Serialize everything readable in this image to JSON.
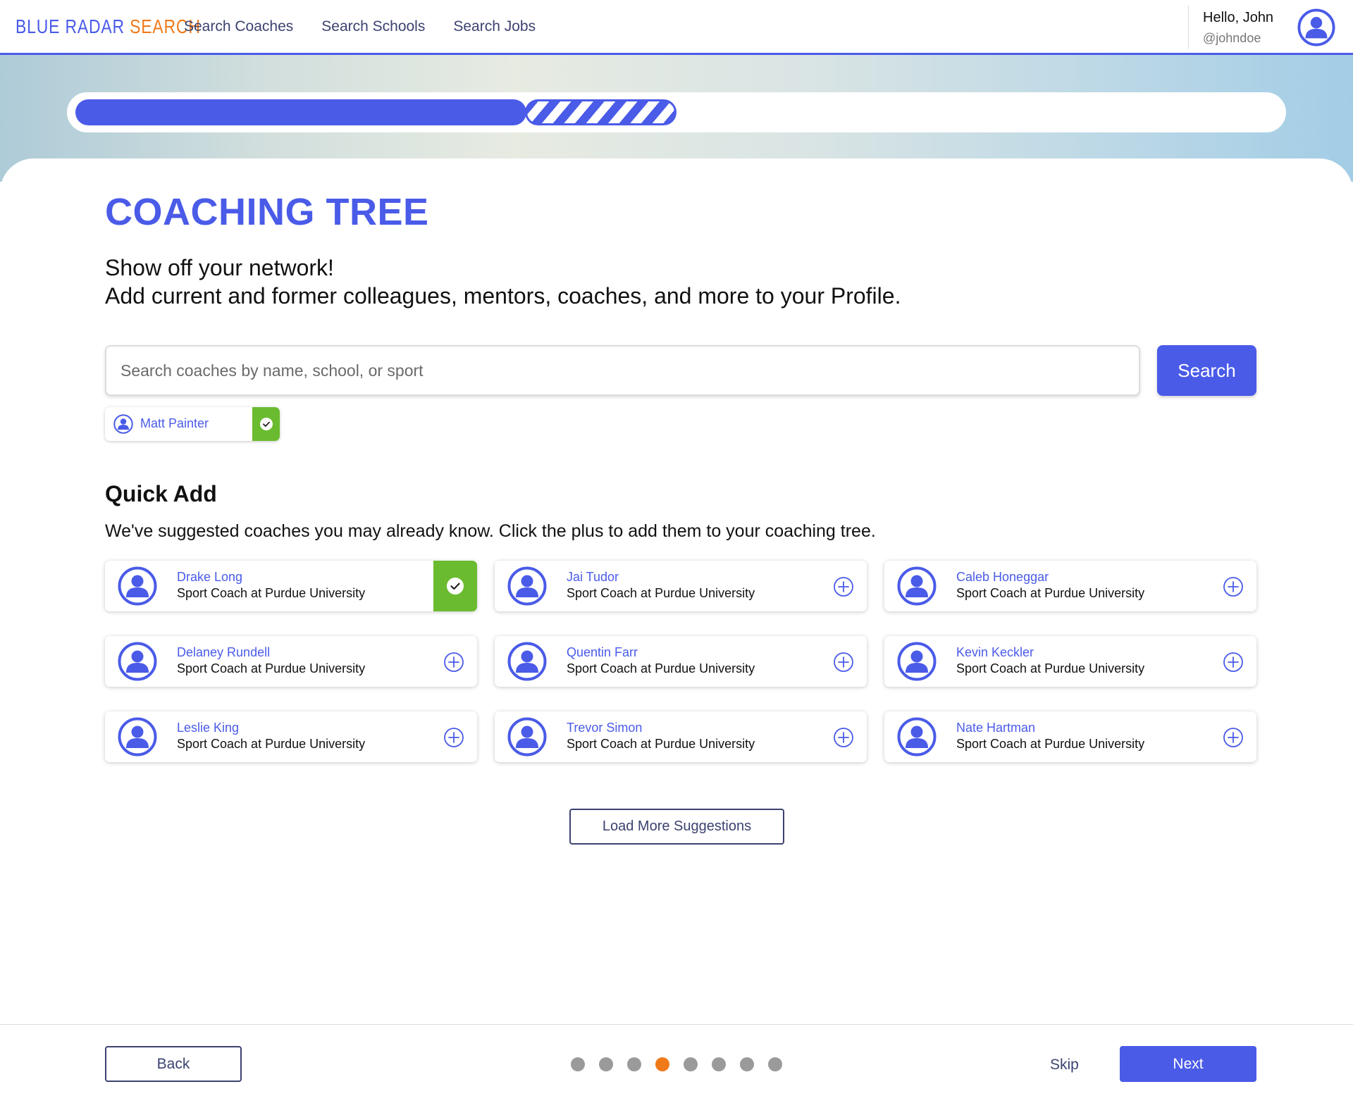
{
  "brand": {
    "logo_part1": "BLUE RADAR ",
    "logo_part2": "SEARCH",
    "blue": "#4a5be8",
    "orange": "#f07a1a"
  },
  "nav": {
    "links": [
      "Search Coaches",
      "Search Schools",
      "Search Jobs"
    ]
  },
  "user": {
    "greeting": "Hello, John",
    "handle": "@johndoe",
    "avatar_icon": "user-circle-icon"
  },
  "progress": {
    "completed_fraction": 0.37,
    "in_progress_fraction": 0.12
  },
  "page": {
    "title": "COACHING TREE",
    "intro_line1": "Show off your network!",
    "intro_line2": "Add current and former colleagues, mentors, coaches, and more to your Profile."
  },
  "search": {
    "placeholder": "Search coaches by name, school, or sport",
    "value": "",
    "button_label": "Search"
  },
  "selected_chip": {
    "name": "Matt Painter",
    "status_icon": "check-circle-icon"
  },
  "quick_add": {
    "title": "Quick Add",
    "description": "We've suggested coaches you may already know. Click the plus to add them to your coaching tree.",
    "add_color": "#6abb2f",
    "coaches": [
      {
        "name": "Drake Long",
        "role": "Sport Coach at Purdue University",
        "added": true
      },
      {
        "name": "Jai Tudor",
        "role": "Sport Coach at Purdue University",
        "added": false
      },
      {
        "name": "Caleb Honeggar",
        "role": "Sport Coach at Purdue University",
        "added": false
      },
      {
        "name": "Delaney Rundell",
        "role": "Sport Coach at Purdue University",
        "added": false
      },
      {
        "name": "Quentin Farr",
        "role": "Sport Coach at Purdue University",
        "added": false
      },
      {
        "name": "Kevin Keckler",
        "role": "Sport Coach at Purdue University",
        "added": false
      },
      {
        "name": "Leslie King",
        "role": "Sport Coach at Purdue University",
        "added": false
      },
      {
        "name": "Trevor Simon",
        "role": "Sport Coach at Purdue University",
        "added": false
      },
      {
        "name": "Nate Hartman",
        "role": "Sport Coach at Purdue University",
        "added": false
      }
    ],
    "load_more_label": "Load More Suggestions"
  },
  "footer": {
    "back_label": "Back",
    "skip_label": "Skip",
    "next_label": "Next",
    "step_count": 8,
    "active_step": 4
  }
}
